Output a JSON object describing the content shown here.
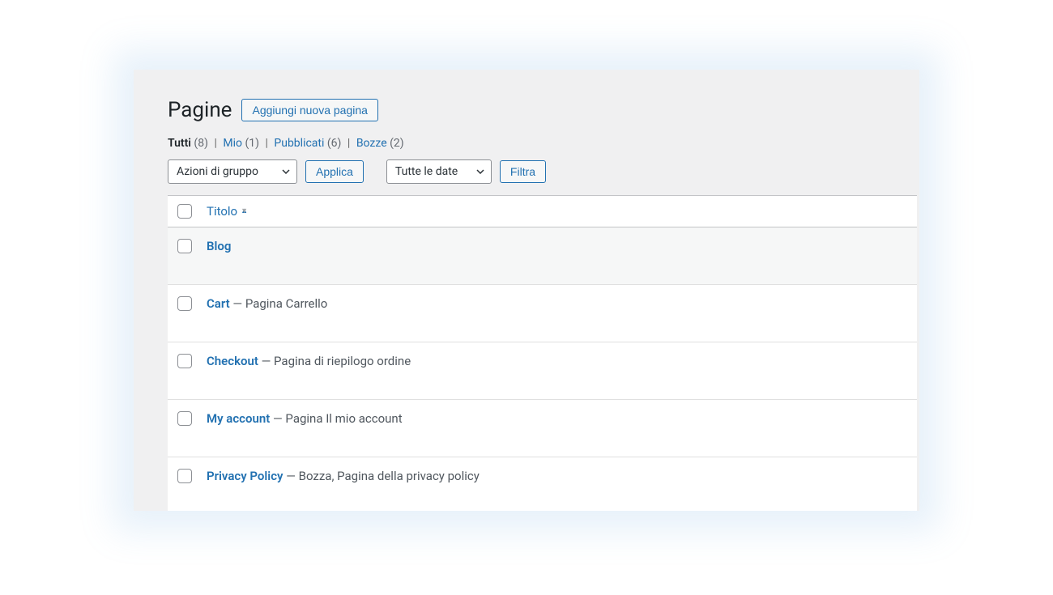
{
  "header": {
    "title": "Pagine",
    "add_button": "Aggiungi nuova pagina"
  },
  "views": [
    {
      "label": "Tutti",
      "count": "(8)",
      "current": true
    },
    {
      "label": "Mio",
      "count": "(1)",
      "current": false
    },
    {
      "label": "Pubblicati",
      "count": "(6)",
      "current": false
    },
    {
      "label": "Bozze",
      "count": "(2)",
      "current": false
    }
  ],
  "filters": {
    "bulk_select": "Azioni di gruppo",
    "apply": "Applica",
    "date_select": "Tutte le date",
    "filter": "Filtra"
  },
  "columns": {
    "title": "Titolo"
  },
  "rows": [
    {
      "title": "Blog",
      "suffix": ""
    },
    {
      "title": "Cart",
      "suffix": " — Pagina Carrello"
    },
    {
      "title": "Checkout",
      "suffix": " — Pagina di riepilogo ordine"
    },
    {
      "title": "My account",
      "suffix": " — Pagina Il mio account"
    },
    {
      "title": "Privacy Policy",
      "suffix": " — Bozza, Pagina della privacy policy"
    }
  ]
}
